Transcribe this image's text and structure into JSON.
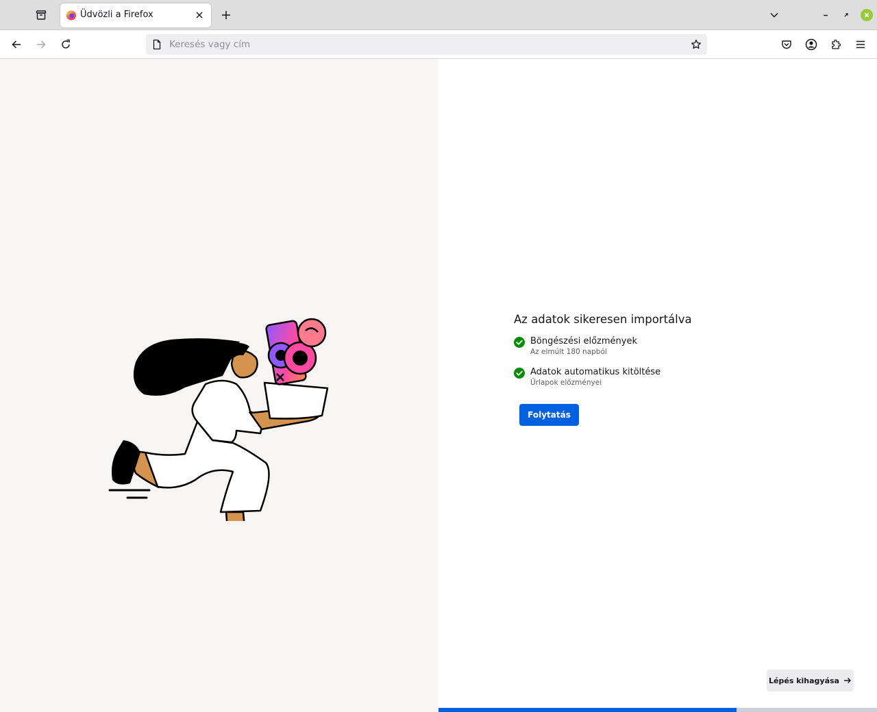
{
  "browser": {
    "tab": {
      "title": "Üdvözli a Firefox"
    },
    "urlbar": {
      "placeholder": "Keresés vagy cím",
      "value": ""
    },
    "icons": {
      "tab_overview": "tab-overview-icon",
      "new_tab": "plus-icon",
      "list_tabs": "chevron-down-icon",
      "back": "arrow-left-icon",
      "forward": "arrow-right-icon",
      "reload": "reload-icon",
      "bookmark": "star-icon",
      "pocket": "pocket-icon",
      "account": "account-icon",
      "extensions": "puzzle-icon",
      "menu": "hamburger-menu-icon"
    }
  },
  "onboarding": {
    "title": "Az adatok sikeresen importálva",
    "items": [
      {
        "label": "Böngészési előzmények",
        "sub": "Az elmúlt 180 napból"
      },
      {
        "label": "Adatok automatikus kitöltése",
        "sub": "Űrlapok előzményei"
      }
    ],
    "continue_label": "Folytatás",
    "skip_label": "Lépés kihagyása",
    "progress": 0.68
  },
  "colors": {
    "accent": "#0061e0",
    "success": "#058b00",
    "left_panel_bg": "#f7f6f4",
    "tabbar_bg": "#dedede"
  }
}
